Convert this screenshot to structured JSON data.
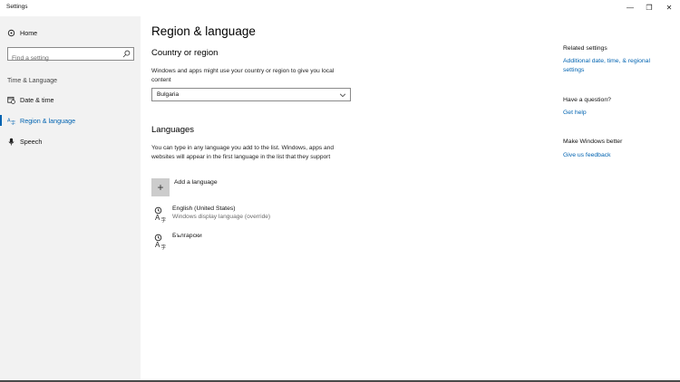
{
  "window": {
    "title": "Settings",
    "minimize_glyph": "—",
    "maximize_glyph": "❐",
    "close_glyph": "✕"
  },
  "sidebar": {
    "home_label": "Home",
    "search_placeholder": "Find a setting",
    "section_label": "Time & Language",
    "items": [
      {
        "label": "Date & time",
        "icon": "calendar-clock-icon",
        "active": false
      },
      {
        "label": "Region & language",
        "icon": "region-language-icon",
        "active": true
      },
      {
        "label": "Speech",
        "icon": "microphone-icon",
        "active": false
      }
    ]
  },
  "main": {
    "title": "Region & language",
    "country": {
      "heading": "Country or region",
      "description": "Windows and apps might use your country or region to give you local content",
      "selected": "Bulgaria"
    },
    "languages": {
      "heading": "Languages",
      "description": "You can type in any language you add to the list. Windows, apps and websites will appear in the first language in the list that they support",
      "add_label": "Add a language",
      "items": [
        {
          "name": "English (United States)",
          "sub": "Windows display language (override)"
        },
        {
          "name": "Български",
          "sub": ""
        }
      ]
    }
  },
  "right": {
    "related_heading": "Related settings",
    "related_link": "Additional date, time, & regional settings",
    "question_heading": "Have a question?",
    "help_link": "Get help",
    "better_heading": "Make Windows better",
    "feedback_link": "Give us feedback"
  },
  "colors": {
    "accent": "#0063b1",
    "sidebar_bg": "#f2f2f2"
  }
}
